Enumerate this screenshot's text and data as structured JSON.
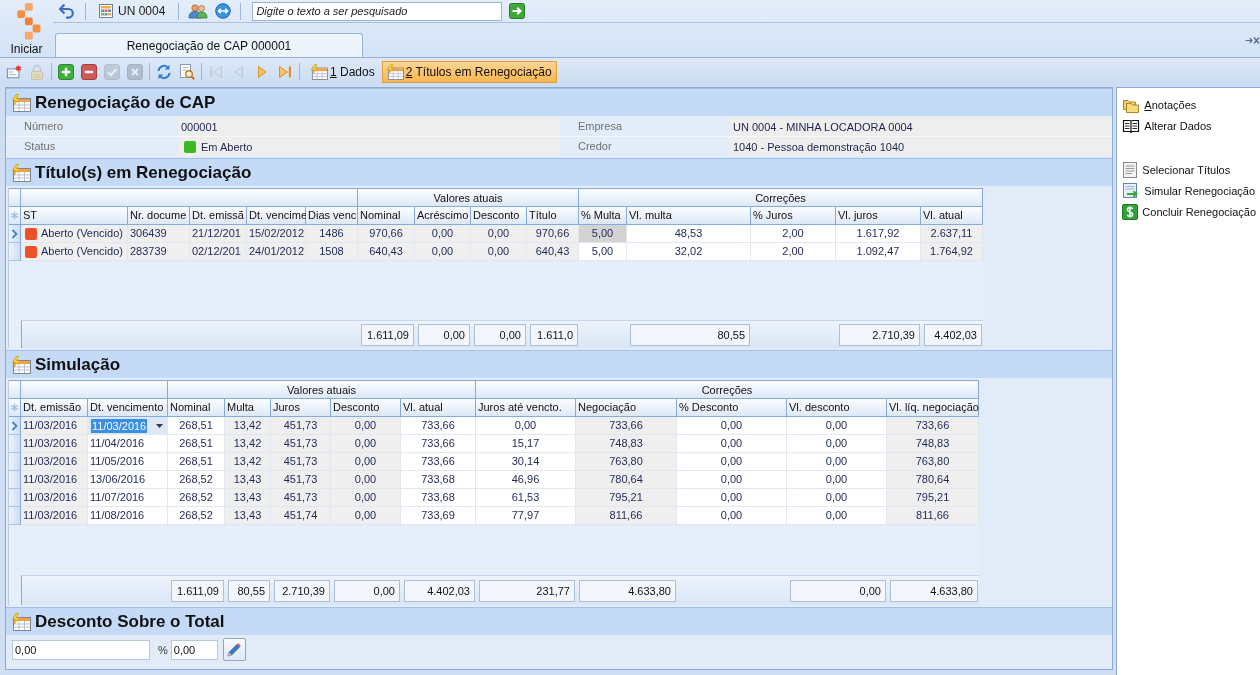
{
  "start_button": {
    "label": "Iniciar"
  },
  "quick_bar": {
    "groups": [
      [
        {
          "kind": "undo"
        }
      ],
      [
        {
          "kind": "company",
          "label": "UN 0004"
        }
      ],
      [
        {
          "kind": "users"
        },
        {
          "kind": "sync"
        }
      ],
      [
        {
          "kind": "search",
          "placeholder": "Digite o texto a ser pesquisado"
        },
        {
          "kind": "go"
        }
      ]
    ]
  },
  "document_tabs": [
    {
      "label": "Renegociação de CAP 000001",
      "selected": true
    }
  ],
  "toolbar": {
    "groups": [
      [
        {
          "kind": "new",
          "disabled": false
        },
        {
          "kind": "lock",
          "disabled": true
        }
      ],
      [
        {
          "kind": "add",
          "disabled": false
        },
        {
          "kind": "remove",
          "disabled": false
        },
        {
          "kind": "confirm",
          "disabled": true
        },
        {
          "kind": "cancel",
          "disabled": true
        }
      ],
      [
        {
          "kind": "refresh",
          "disabled": false
        },
        {
          "kind": "preview",
          "disabled": false
        }
      ],
      [
        {
          "kind": "first",
          "disabled": true
        },
        {
          "kind": "previous",
          "disabled": true
        },
        {
          "kind": "next",
          "disabled": false
        },
        {
          "kind": "last",
          "disabled": false
        }
      ]
    ],
    "views": [
      {
        "label": "1 Dados",
        "selected": false,
        "shortcut_underlined": true
      },
      {
        "label": "2 Títulos em Renegociação",
        "selected": true,
        "shortcut_underlined": true
      }
    ]
  },
  "record": {
    "title": "Renegociação de CAP",
    "fields": [
      {
        "label": "Número",
        "value": "000001"
      },
      {
        "label": "Empresa",
        "value": "UN 0004 - MINHA LOCADORA 0004"
      },
      {
        "label": "Status",
        "value": "Em Aberto",
        "color": "#3cb922"
      },
      {
        "label": "Credor",
        "value": "1040 - Pessoa demonstração 1040"
      }
    ]
  },
  "titles": {
    "title": "Título(s) em Renegociação",
    "editing": false,
    "bands": [
      {
        "columns": [
          {
            "label": "ST",
            "kind": "status",
            "editable": false,
            "focused": false
          },
          {
            "label": "Nr. docume",
            "editable": false,
            "focused": false
          },
          {
            "label": "Dt. emissã",
            "editable": false,
            "focused": false
          },
          {
            "label": "Dt. vencime",
            "editable": false,
            "focused": false
          },
          {
            "label": "Dias venc",
            "editable": false,
            "focused": false
          }
        ]
      },
      {
        "label": "Valores atuais",
        "columns": [
          {
            "label": "Nominal",
            "editable": false,
            "focused": false,
            "footer": "1.611,09"
          },
          {
            "label": "Acréscimo",
            "editable": false,
            "focused": false,
            "footer": "0,00"
          },
          {
            "label": "Desconto",
            "editable": false,
            "focused": false,
            "footer": "0,00"
          },
          {
            "label": "Título",
            "editable": false,
            "focused": false,
            "footer": "1.611,0"
          }
        ]
      },
      {
        "label": "Correções",
        "columns": [
          {
            "label": "% Multa",
            "editable": true,
            "focused": true
          },
          {
            "label": "Vl. multa",
            "editable": true,
            "focused": false,
            "footer": "80,55"
          },
          {
            "label": "% Juros",
            "editable": true,
            "focused": false
          },
          {
            "label": "Vl. juros",
            "editable": true,
            "focused": false,
            "footer": "2.710,39"
          },
          {
            "label": "Vl. atual",
            "editable": false,
            "focused": false,
            "footer": "4.402,03"
          }
        ]
      }
    ],
    "rows": [
      {
        "selected": true,
        "color": "#ee5128",
        "cells": [
          "Aberto (Vencido)",
          "306439",
          "21/12/201",
          "15/02/2012",
          "1486",
          "970,66",
          "0,00",
          "0,00",
          "970,66",
          "5,00",
          "48,53",
          "2,00",
          "1.617,92",
          "2.637,11"
        ]
      },
      {
        "selected": false,
        "color": "#ee5128",
        "cells": [
          "Aberto (Vencido)",
          "283739",
          "02/12/201",
          "24/01/2012",
          "1508",
          "640,43",
          "0,00",
          "0,00",
          "640,43",
          "5,00",
          "32,02",
          "2,00",
          "1.092,47",
          "1.764,92"
        ]
      }
    ]
  },
  "simulation": {
    "title": "Simulação",
    "editing": true,
    "bands": [
      {
        "columns": [
          {
            "label": "Dt. emissão",
            "editable": false,
            "focused": false
          },
          {
            "label": "Dt. vencimento",
            "editable": true,
            "focused": true
          }
        ]
      },
      {
        "label": "Valores atuais",
        "columns": [
          {
            "label": "Nominal",
            "editable": true,
            "focused": false,
            "footer": "1.611,09"
          },
          {
            "label": "Multa",
            "editable": false,
            "focused": false,
            "footer": "80,55"
          },
          {
            "label": "Juros",
            "editable": false,
            "focused": false,
            "footer": "2.710,39"
          },
          {
            "label": "Desconto",
            "editable": false,
            "focused": false,
            "footer": "0,00"
          },
          {
            "label": "Vl. atual",
            "editable": true,
            "focused": false,
            "footer": "4.402,03"
          }
        ]
      },
      {
        "label": "Correções",
        "columns": [
          {
            "label": "Juros até vencto.",
            "editable": true,
            "focused": false,
            "footer": "231,77"
          },
          {
            "label": "Negociação",
            "editable": false,
            "focused": false,
            "footer": "4.633,80"
          },
          {
            "label": "% Desconto",
            "editable": true,
            "focused": false
          },
          {
            "label": "Vl. desconto",
            "editable": true,
            "focused": false,
            "footer": "0,00"
          },
          {
            "label": "Vl. líq. negociação",
            "editable": false,
            "focused": false,
            "footer": "4.633,80"
          }
        ]
      }
    ],
    "rows": [
      {
        "selected": true,
        "cells": [
          "11/03/2016",
          "11/03/2016",
          "268,51",
          "13,42",
          "451,73",
          "0,00",
          "733,66",
          "0,00",
          "733,66",
          "0,00",
          "0,00",
          "733,66"
        ]
      },
      {
        "selected": false,
        "cells": [
          "11/03/2016",
          "11/04/2016",
          "268,51",
          "13,42",
          "451,73",
          "0,00",
          "733,66",
          "15,17",
          "748,83",
          "0,00",
          "0,00",
          "748,83"
        ]
      },
      {
        "selected": false,
        "cells": [
          "11/03/2016",
          "11/05/2016",
          "268,51",
          "13,42",
          "451,73",
          "0,00",
          "733,66",
          "30,14",
          "763,80",
          "0,00",
          "0,00",
          "763,80"
        ]
      },
      {
        "selected": false,
        "cells": [
          "11/03/2016",
          "13/06/2016",
          "268,52",
          "13,43",
          "451,73",
          "0,00",
          "733,68",
          "46,96",
          "780,64",
          "0,00",
          "0,00",
          "780,64"
        ]
      },
      {
        "selected": false,
        "cells": [
          "11/03/2016",
          "11/07/2016",
          "268,52",
          "13,43",
          "451,73",
          "0,00",
          "733,68",
          "61,53",
          "795,21",
          "0,00",
          "0,00",
          "795,21"
        ]
      },
      {
        "selected": false,
        "cells": [
          "11/03/2016",
          "11/08/2016",
          "268,52",
          "13,43",
          "451,74",
          "0,00",
          "733,69",
          "77,97",
          "811,66",
          "0,00",
          "0,00",
          "811,66"
        ]
      }
    ]
  },
  "discount": {
    "title": "Desconto Sobre o Total",
    "amount": "0,00",
    "percent_label": "%",
    "percent": "0,00"
  },
  "actions": {
    "groups": [
      [
        {
          "kind": "notes",
          "label": "Anotações",
          "shortcut_underlined": true
        },
        {
          "kind": "edit",
          "label": "Alterar Dados",
          "shortcut_underlined": false
        }
      ],
      [
        {
          "kind": "select",
          "label": "Selecionar Títulos",
          "shortcut_underlined": false
        },
        {
          "kind": "simulate",
          "label": "Simular Renegociação",
          "shortcut_underlined": false
        },
        {
          "kind": "conclude",
          "label": "Concluir Renegociação",
          "shortcut_underlined": false
        }
      ]
    ]
  }
}
